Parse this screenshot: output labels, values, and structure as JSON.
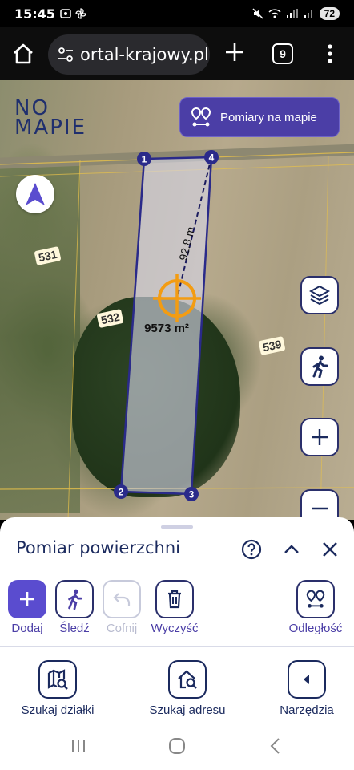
{
  "status_bar": {
    "time": "15:45",
    "battery": "72"
  },
  "browser": {
    "url": "ortal-krajowy.pl",
    "tab_count": "9"
  },
  "map": {
    "logo_line1": "NO",
    "logo_line2": "MAPIE",
    "measure_button": "Pomiary na mapie",
    "distance_label": "92.8 m",
    "area_label": "9573 m²",
    "vertices": [
      "1",
      "4",
      "2",
      "3"
    ],
    "plot_numbers": [
      "531",
      "532",
      "539"
    ],
    "polygon_color": "#2a2a8a",
    "crosshair_color": "#f39c12"
  },
  "sheet": {
    "title": "Pomiar powierzchni",
    "tools": [
      {
        "label": "Dodaj",
        "icon": "plus-icon",
        "state": "active"
      },
      {
        "label": "Śledź",
        "icon": "walk-icon",
        "state": "normal"
      },
      {
        "label": "Cofnij",
        "icon": "undo-icon",
        "state": "disabled"
      },
      {
        "label": "Wyczyść",
        "icon": "trash-icon",
        "state": "normal"
      },
      {
        "label": "Odległość",
        "icon": "route-icon",
        "state": "normal"
      }
    ]
  },
  "bottom_nav": [
    {
      "label": "Szukaj działki",
      "icon": "map-search-icon"
    },
    {
      "label": "Szukaj adresu",
      "icon": "home-search-icon"
    },
    {
      "label": "Narzędzia",
      "icon": "triangle-left-icon"
    }
  ],
  "colors": {
    "accent": "#5a4ccf",
    "dark_blue": "#1b2a5e"
  }
}
